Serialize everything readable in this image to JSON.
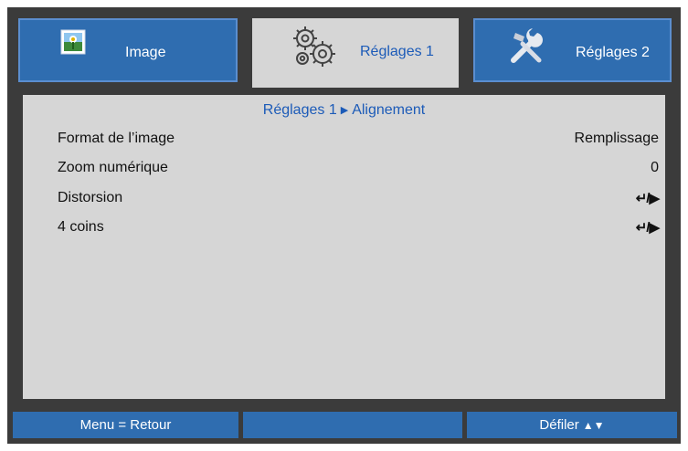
{
  "tabs": [
    {
      "label": "Image",
      "icon": "picture-icon",
      "active": false
    },
    {
      "label": "Réglages 1",
      "icon": "gears-icon",
      "active": true
    },
    {
      "label": "Réglages 2",
      "icon": "tools-icon",
      "active": false
    }
  ],
  "breadcrumb": {
    "parent": "Réglages 1",
    "separator_icon": "triangle-right-icon",
    "current": "Alignement"
  },
  "menu_items": [
    {
      "label": "Format de l’image",
      "value": "Remplissage"
    },
    {
      "label": "Zoom numérique",
      "value": "0"
    },
    {
      "label": "Distorsion",
      "value": "↵/▶"
    },
    {
      "label": "4 coins",
      "value": "↵/▶"
    }
  ],
  "footer": {
    "left": "Menu = Retour",
    "middle": "",
    "right": "Défiler",
    "right_icons": [
      "triangle-up-icon",
      "triangle-down-icon"
    ]
  },
  "colors": {
    "frame": "#3b3b3b",
    "tab_blue": "#2f6db0",
    "panel_bg": "#d6d6d6",
    "accent_text": "#1c5bb8"
  }
}
